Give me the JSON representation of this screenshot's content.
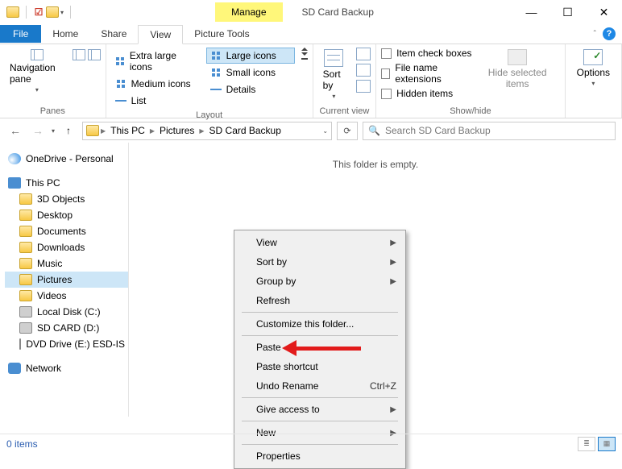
{
  "title": {
    "manage": "Manage",
    "window": "SD Card Backup",
    "picture_tools": "Picture Tools"
  },
  "tabs": {
    "file": "File",
    "home": "Home",
    "share": "Share",
    "view": "View"
  },
  "ribbon": {
    "panes": {
      "label": "Navigation pane",
      "group": "Panes"
    },
    "layout": {
      "group": "Layout",
      "items": [
        "Extra large icons",
        "Large icons",
        "Medium icons",
        "Small icons",
        "List",
        "Details"
      ]
    },
    "current_view": {
      "group": "Current view",
      "sort": "Sort by"
    },
    "show_hide": {
      "group": "Show/hide",
      "checks": [
        "Item check boxes",
        "File name extensions",
        "Hidden items"
      ],
      "hide": "Hide selected items"
    },
    "options": "Options"
  },
  "breadcrumb": [
    "This PC",
    "Pictures",
    "SD Card Backup"
  ],
  "search": {
    "placeholder": "Search SD Card Backup"
  },
  "tree": {
    "onedrive": "OneDrive - Personal",
    "this_pc": "This PC",
    "items": [
      "3D Objects",
      "Desktop",
      "Documents",
      "Downloads",
      "Music",
      "Pictures",
      "Videos",
      "Local Disk (C:)",
      "SD CARD (D:)",
      "DVD Drive (E:) ESD-IS"
    ],
    "network": "Network"
  },
  "content": {
    "empty": "This folder is empty."
  },
  "context": {
    "view": "View",
    "sort": "Sort by",
    "group": "Group by",
    "refresh": "Refresh",
    "customize": "Customize this folder...",
    "paste": "Paste",
    "paste_shortcut": "Paste shortcut",
    "undo": "Undo Rename",
    "undo_sc": "Ctrl+Z",
    "give": "Give access to",
    "new": "New",
    "properties": "Properties"
  },
  "status": {
    "items": "0 items"
  }
}
